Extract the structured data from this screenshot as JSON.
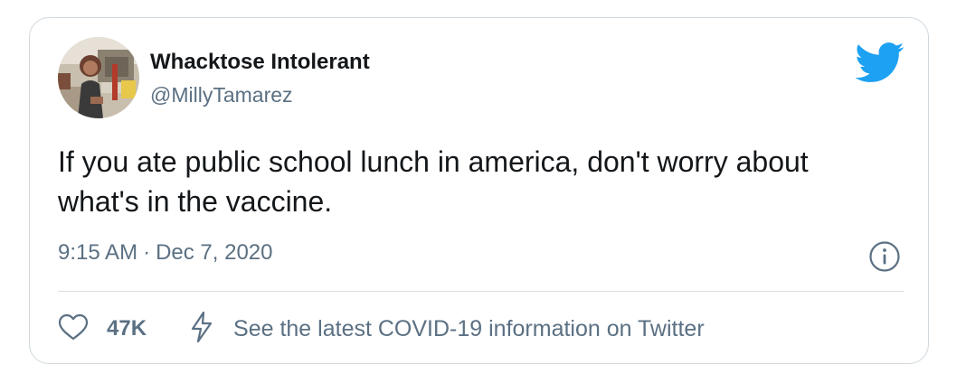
{
  "tweet": {
    "author": {
      "display_name": "Whacktose Intolerant",
      "handle": "@MillyTamarez",
      "avatar_icon": "user-avatar"
    },
    "text": "If you ate public school lunch in america, don't worry about what's in the vaccine.",
    "time": "9:15 AM",
    "separator": "·",
    "date": "Dec 7, 2020",
    "likes": "47K",
    "covid_link": "See the latest COVID-19 information on Twitter"
  },
  "icons": {
    "brand": "twitter-bird-icon",
    "info": "info-icon",
    "like": "heart-icon",
    "covid": "lightning-icon"
  },
  "colors": {
    "brand": "#1da1f2",
    "text_primary": "#14171a",
    "text_secondary": "#5b7083",
    "border": "#d0d8de"
  }
}
